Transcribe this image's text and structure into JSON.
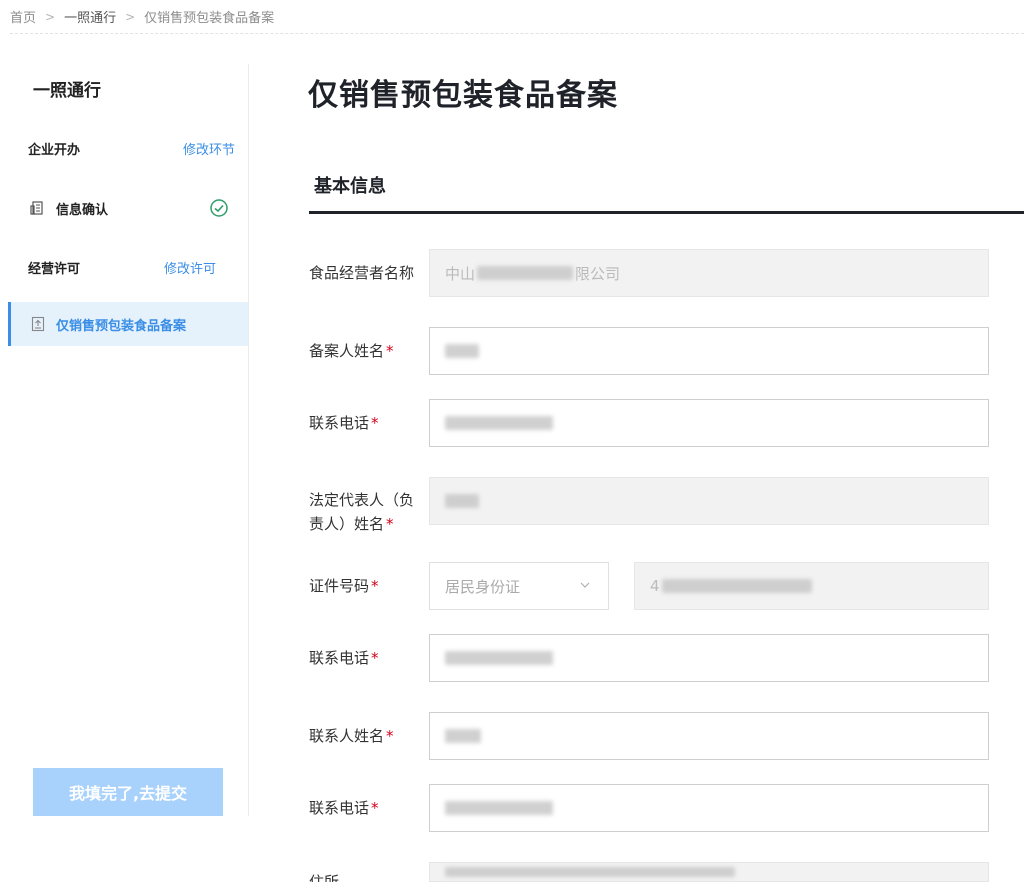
{
  "breadcrumb": {
    "items": [
      "首页",
      "一照通行",
      "仅销售预包装食品备案"
    ],
    "separator": ">"
  },
  "sidebar": {
    "title": "一照通行",
    "sections": [
      {
        "label": "企业开办",
        "link": "修改环节"
      },
      {
        "label": "信息确认",
        "status_icon": "check-circle-icon"
      },
      {
        "label": "经营许可",
        "link": "修改许可"
      },
      {
        "label": "仅销售预包装食品备案",
        "active": true
      }
    ],
    "submit_label": "我填完了,去提交"
  },
  "main": {
    "title": "仅销售预包装食品备案",
    "section_title": "基本信息",
    "fields": {
      "operator_name": {
        "label": "食品经营者名称",
        "value_start": "中山",
        "value_end": "限公司"
      },
      "filer_name": {
        "label": "备案人姓名",
        "required": "*"
      },
      "filer_phone": {
        "label": "联系电话",
        "required": "*"
      },
      "legal_rep": {
        "label_line1": "法定代表人（负",
        "label_line2": "责人）姓名",
        "required": "*"
      },
      "id_number": {
        "label": "证件号码",
        "required": "*",
        "id_type": "居民身份证",
        "value_start": "4"
      },
      "legal_phone": {
        "label": "联系电话",
        "required": "*"
      },
      "contact_name": {
        "label": "联系人姓名",
        "required": "*"
      },
      "contact_phone": {
        "label": "联系电话",
        "required": "*"
      },
      "address": {
        "label": "住所"
      }
    }
  },
  "colors": {
    "accent": "#3a8ee6",
    "active_bg": "#e5f1fb",
    "required": "#d0021b",
    "submit_bg": "#a8d2fb",
    "disabled_bg": "#f2f2f2"
  }
}
